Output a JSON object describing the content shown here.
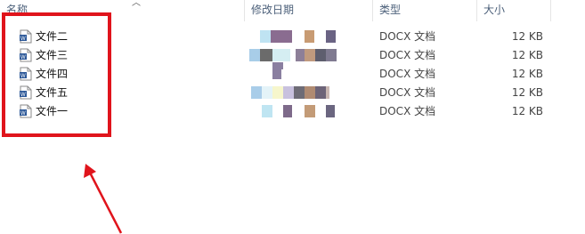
{
  "header": {
    "name": "名称",
    "date_modified": "修改日期",
    "type": "类型",
    "size": "大小"
  },
  "files": [
    {
      "name": "文件二",
      "type": "DOCX 文档",
      "size": "12 KB",
      "icon": "word-document-icon"
    },
    {
      "name": "文件三",
      "type": "DOCX 文档",
      "size": "12 KB",
      "icon": "word-document-icon"
    },
    {
      "name": "文件四",
      "type": "DOCX 文档",
      "size": "12 KB",
      "icon": "word-document-icon"
    },
    {
      "name": "文件五",
      "type": "DOCX 文档",
      "size": "12 KB",
      "icon": "word-document-icon"
    },
    {
      "name": "文件一",
      "type": "DOCX 文档",
      "size": "12 KB",
      "icon": "word-document-icon"
    }
  ],
  "annotation": {
    "highlight_color": "#e0141c",
    "arrow_color": "#e0141c"
  }
}
